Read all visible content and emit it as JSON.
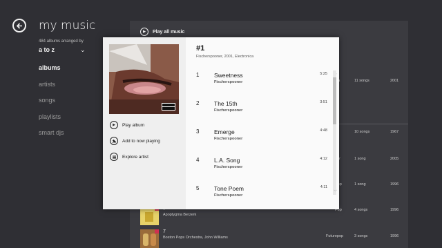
{
  "header": {
    "title": "my music",
    "arrange_label": "484 albums arranged by",
    "arrange_value": "a to z"
  },
  "nav": [
    {
      "label": "albums",
      "active": true
    },
    {
      "label": "artists",
      "active": false
    },
    {
      "label": "songs",
      "active": false
    },
    {
      "label": "playlists",
      "active": false
    },
    {
      "label": "smart djs",
      "active": false
    }
  ],
  "play_all": "Play all music",
  "bg_rows": [
    {
      "genre": "ica",
      "songs": "11 songs",
      "year": "2001"
    },
    {
      "genre": "",
      "songs": "10 songs",
      "year": "1967"
    },
    {
      "genre": "her",
      "songs": "1 song",
      "year": "2005"
    },
    {
      "genre": "Pop",
      "songs": "1 song",
      "year": "1996"
    },
    {
      "genre": "Pop",
      "songs": "4 songs",
      "year": "1996"
    },
    {
      "genre": "Futurepop",
      "songs": "3 songs",
      "year": "1996"
    }
  ],
  "bg_albums": [
    {
      "title": "7",
      "artist": "Apoptygma Berzerk"
    },
    {
      "title": "7",
      "artist": "Boston Pops Orchestra, John Williams"
    }
  ],
  "popup": {
    "album_title": "#1",
    "album_meta": "Fischerspooner, 2001, Electronica",
    "advisory": "PARENTAL ADVISORY EXPLICIT CONTENT",
    "actions": {
      "play_album": "Play album",
      "add_now_playing": "Add to now playing",
      "explore_artist": "Explore artist"
    },
    "tracks": [
      {
        "num": "1",
        "name": "Sweetness",
        "artist": "Fischerspooner",
        "duration": "5:25"
      },
      {
        "num": "2",
        "name": "The 15th",
        "artist": "Fischerspooner",
        "duration": "3:51"
      },
      {
        "num": "3",
        "name": "Emerge",
        "artist": "Fischerspooner",
        "duration": "4:48"
      },
      {
        "num": "4",
        "name": "L.A. Song",
        "artist": "Fischerspooner",
        "duration": "4:12"
      },
      {
        "num": "5",
        "name": "Tone Poem",
        "artist": "Fischerspooner",
        "duration": "4:11"
      }
    ]
  },
  "colors": {
    "background": "#2f2f34",
    "panel": "#3b3b40",
    "popup_left": "#efefef",
    "popup_right": "#fafafa"
  }
}
